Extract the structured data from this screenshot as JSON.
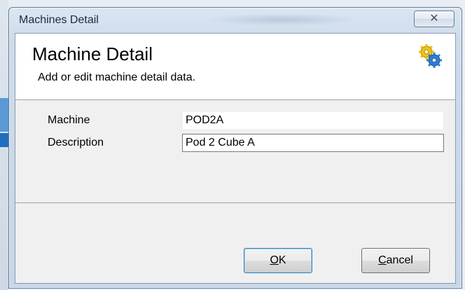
{
  "window": {
    "title": "Machines Detail",
    "close_glyph": "✕"
  },
  "header": {
    "title": "Machine Detail",
    "subtitle": "Add or edit machine detail data.",
    "icon": "gears-icon"
  },
  "form": {
    "machine_label": "Machine",
    "machine_value": "POD2A",
    "description_label": "Description",
    "description_value": "Pod 2 Cube A"
  },
  "buttons": {
    "ok_mnemonic": "O",
    "ok_rest": "K",
    "cancel_mnemonic": "C",
    "cancel_rest": "ancel"
  },
  "colors": {
    "accent_focus": "#3c7fb1",
    "frame": "#5f7896"
  }
}
